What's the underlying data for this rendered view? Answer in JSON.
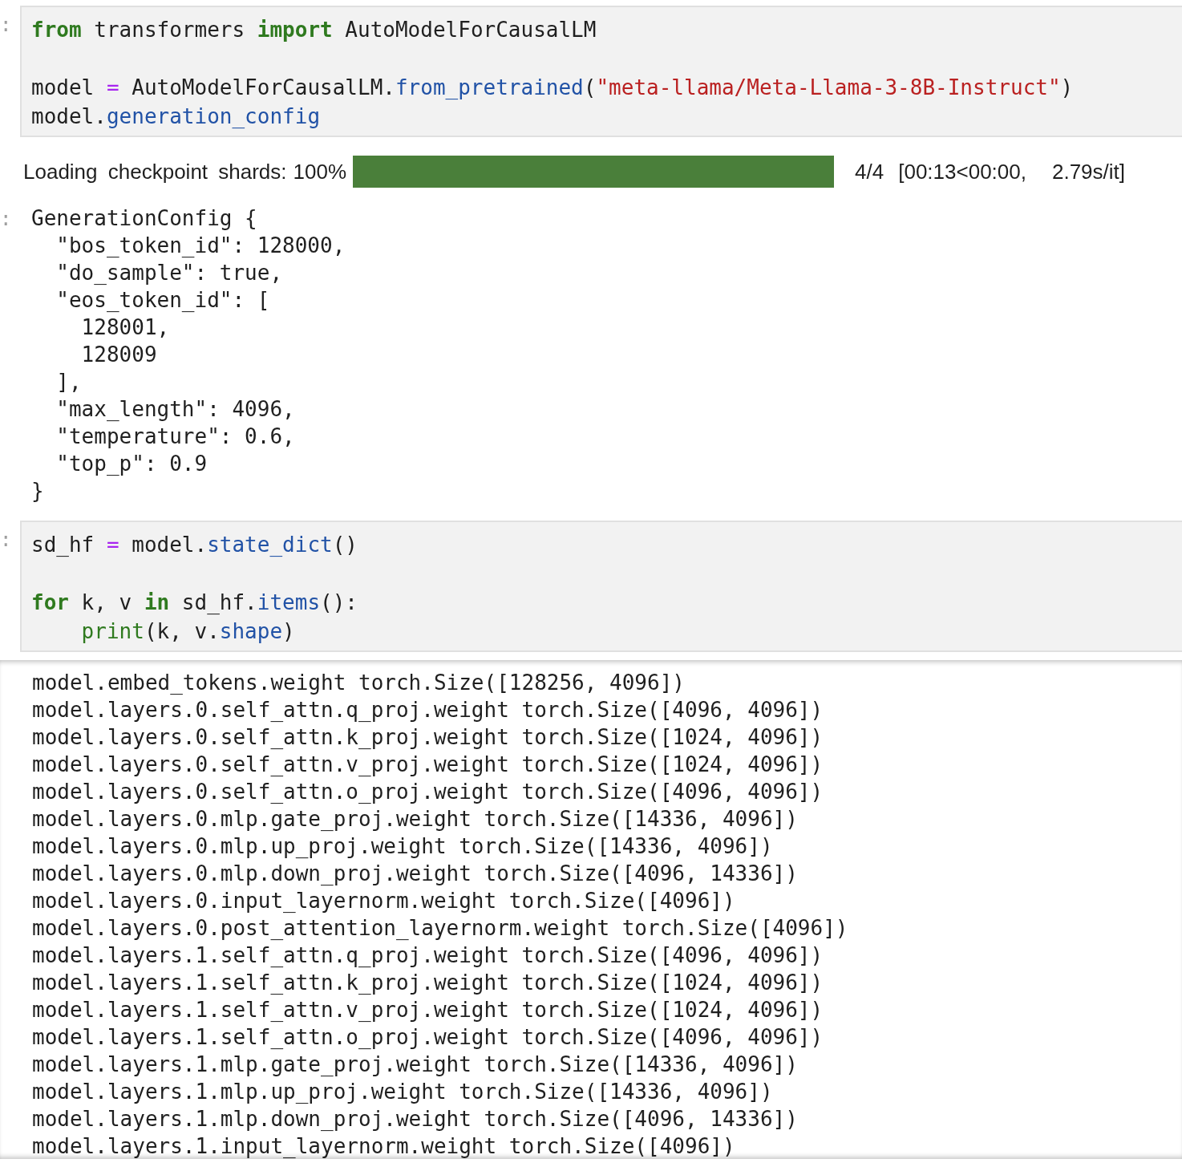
{
  "cells": [
    {
      "kind": "code",
      "prompt": ":",
      "lines": [
        {
          "gap_before": false,
          "tokens": [
            {
              "keyword": "from"
            },
            {
              "plain": " transformers "
            },
            {
              "keyword": "import"
            },
            {
              "plain": " AutoModelForCausalLM"
            }
          ]
        },
        {
          "gap_before": true,
          "tokens": [
            {
              "plain": "model "
            },
            {
              "operator": "="
            },
            {
              "plain": " AutoModelForCausalLM."
            },
            {
              "attribute": "from_pretrained"
            },
            {
              "plain": "("
            },
            {
              "string": "\"meta-llama/Meta-Llama-3-8B-Instruct\""
            },
            {
              "plain": ")"
            }
          ]
        },
        {
          "gap_before": false,
          "tokens": [
            {
              "plain": "model."
            },
            {
              "attribute": "generation_config"
            }
          ]
        }
      ]
    },
    {
      "kind": "progress",
      "label": "Loading checkpoint shards:",
      "percent": "100%",
      "level": 1,
      "count": "4/4",
      "timing": "[00:13<00:00,",
      "rate": "2.79s/it]"
    },
    {
      "kind": "text_output",
      "prompt": ":",
      "lines": [
        "GenerationConfig {",
        "  \"bos_token_id\": 128000,",
        "  \"do_sample\": true,",
        "  \"eos_token_id\": [",
        "    128001,",
        "    128009",
        "  ],",
        "  \"max_length\": 4096,",
        "  \"temperature\": 0.6,",
        "  \"top_p\": 0.9",
        "}"
      ]
    },
    {
      "kind": "code",
      "prompt": ":",
      "lines": [
        {
          "gap_before": false,
          "tokens": [
            {
              "plain": "sd_hf "
            },
            {
              "operator": "="
            },
            {
              "plain": " model."
            },
            {
              "attribute": "state_dict"
            },
            {
              "plain": "()"
            }
          ]
        },
        {
          "gap_before": true,
          "tokens": [
            {
              "keyword": "for"
            },
            {
              "plain": " k, v "
            },
            {
              "keyword": "in"
            },
            {
              "plain": " sd_hf."
            },
            {
              "attribute": "items"
            },
            {
              "plain": "():"
            }
          ]
        },
        {
          "gap_before": false,
          "indented": true,
          "tokens": [
            {
              "builtin": "print"
            },
            {
              "plain": "(k, v."
            },
            {
              "attribute": "shape"
            },
            {
              "plain": ")"
            }
          ]
        }
      ]
    },
    {
      "kind": "stream_output",
      "scrolled": true,
      "lines": [
        "model.embed_tokens.weight torch.Size([128256, 4096])",
        "model.layers.0.self_attn.q_proj.weight torch.Size([4096, 4096])",
        "model.layers.0.self_attn.k_proj.weight torch.Size([1024, 4096])",
        "model.layers.0.self_attn.v_proj.weight torch.Size([1024, 4096])",
        "model.layers.0.self_attn.o_proj.weight torch.Size([4096, 4096])",
        "model.layers.0.mlp.gate_proj.weight torch.Size([14336, 4096])",
        "model.layers.0.mlp.up_proj.weight torch.Size([14336, 4096])",
        "model.layers.0.mlp.down_proj.weight torch.Size([4096, 14336])",
        "model.layers.0.input_layernorm.weight torch.Size([4096])",
        "model.layers.0.post_attention_layernorm.weight torch.Size([4096])",
        "model.layers.1.self_attn.q_proj.weight torch.Size([4096, 4096])",
        "model.layers.1.self_attn.k_proj.weight torch.Size([1024, 4096])",
        "model.layers.1.self_attn.v_proj.weight torch.Size([1024, 4096])",
        "model.layers.1.self_attn.o_proj.weight torch.Size([4096, 4096])",
        "model.layers.1.mlp.gate_proj.weight torch.Size([14336, 4096])",
        "model.layers.1.mlp.up_proj.weight torch.Size([14336, 4096])",
        "model.layers.1.mlp.down_proj.weight torch.Size([4096, 14336])",
        "model.layers.1.input_layernorm.weight torch.Size([4096])"
      ]
    }
  ]
}
